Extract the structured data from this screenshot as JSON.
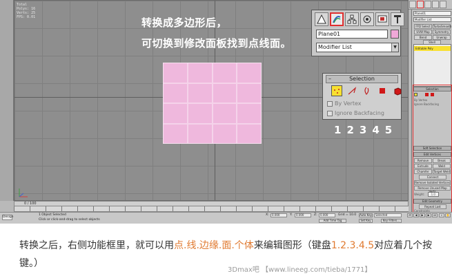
{
  "viewport": {
    "stats_lines": [
      "",
      "Total",
      "Polys: 16",
      "Verts: 25",
      "",
      "FPS: 0.01"
    ],
    "annotation_line1": "转换成多边形后，",
    "annotation_line2": "可切换到修改面板找到点线面。"
  },
  "plane_grid": {
    "rows": 4,
    "cols": 4
  },
  "command_zoom": {
    "object_name": "Plane01",
    "modifier_list": "Modifier List"
  },
  "selection_zoom": {
    "title": "Selection",
    "by_vertex": "By Vertex",
    "ignore_backfacing": "Ignore Backfacing"
  },
  "numbers": [
    "1",
    "2",
    "3",
    "4",
    "5"
  ],
  "right_panel": {
    "object_name": "Plane01",
    "modifier_list": "Modifier List",
    "buttons": [
      "FFD Select",
      "TurboSmooth",
      "UVW Map",
      "Symmetry",
      "Bend",
      "Unwrap",
      "Shell"
    ],
    "stack_item": "Editable Poly",
    "selection_head": "Selection",
    "soft_selection_head": "Soft Selection",
    "edit_vertices_head": "Edit Vertices",
    "edit_geometry_head": "Edit Geometry",
    "repeat_last": "Repeat Last",
    "constraints": "Constraints",
    "constraint_none": "None",
    "constraint_edge": "Edge",
    "ev_buttons": [
      "Remove",
      "Break",
      "Extrude",
      "Weld",
      "Chamfer",
      "Target Weld",
      "Connect",
      "Remove Isolated Vertices",
      "Remove Unused Map Verts"
    ],
    "weight_label": "Weight:",
    "weight_value": "1.0"
  },
  "timeline": {
    "frame": "0 / 100"
  },
  "status": {
    "selected": "1 Object Selected",
    "hint": "Click or click-and-drag to select objects",
    "x_label": "X:",
    "x_value": "0.000",
    "y_label": "Y:",
    "y_value": "0.000",
    "z_label": "Z:",
    "z_value": "0.000",
    "grid": "Grid = 10.0",
    "auto_key": "Auto Key",
    "set_key": "Set Key",
    "selected_dd": "Selected",
    "key_filters": "Key Filters...",
    "add_time_tag": "Add Time Tag",
    "script_label": "Design"
  },
  "caption": {
    "part1": "转换之后，右侧功能框里，就可以用",
    "highlight1": "点.线.边缘.面.个体",
    "part2": "来编辑图形（键盘",
    "highlight2": "1.2.3.4.5",
    "part3": "对应着几个按键。）"
  },
  "watermark": "3Dmax吧 【www.lineeg.com/tieba/1771】",
  "colors": {
    "plane_fill": "#efb8dd",
    "highlight_red": "#e03030",
    "caption_orange": "#e07a30",
    "active_yellow": "#f8e030"
  }
}
